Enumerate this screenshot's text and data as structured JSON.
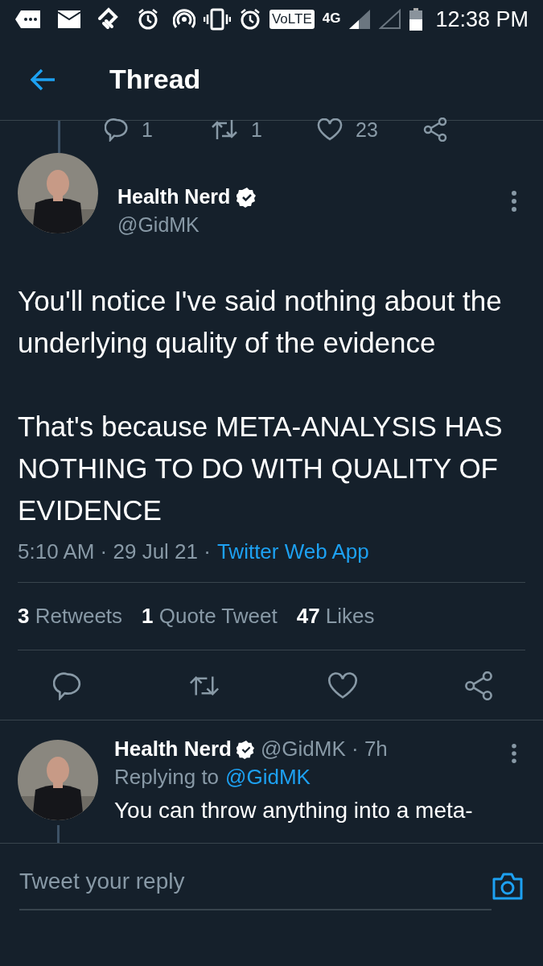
{
  "status_bar": {
    "volte": "VoLTE",
    "network": "4G",
    "time": "12:38 PM"
  },
  "header": {
    "title": "Thread"
  },
  "previous_tweet_actions": {
    "replies": "1",
    "retweets": "1",
    "likes": "23"
  },
  "tweet": {
    "name": "Health Nerd",
    "verified": true,
    "handle": "@GidMK",
    "paragraphs": [
      "You'll notice I've said nothing about the underlying quality of the evidence",
      "That's because META-ANALYSIS HAS NOTHING TO DO WITH QUALITY OF EVIDENCE"
    ],
    "meta": "5:10 AM · 29 Jul 21 ·",
    "source": "Twitter Web App",
    "stats": [
      {
        "count": "3",
        "label": "Retweets"
      },
      {
        "count": "1",
        "label": "Quote Tweet"
      },
      {
        "count": "47",
        "label": "Likes"
      }
    ]
  },
  "reply": {
    "name": "Health Nerd",
    "verified": true,
    "handle_age": "@GidMK · 7h",
    "replying_label": "Replying to",
    "replying_to": "@GidMK",
    "text": "You can throw anything into a meta-"
  },
  "composer": {
    "placeholder": "Tweet your reply"
  }
}
